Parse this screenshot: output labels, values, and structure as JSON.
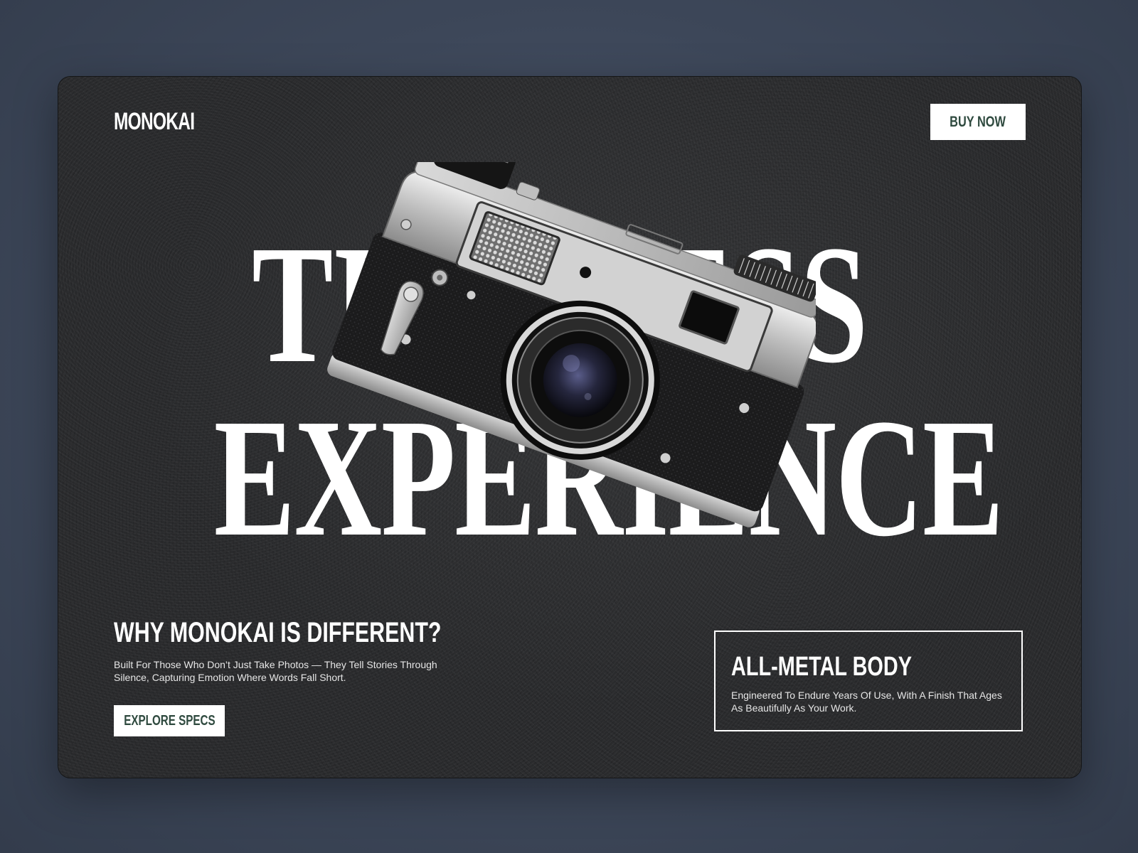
{
  "brand": {
    "logo": "MONOKAI"
  },
  "header": {
    "buy_label": "BUY NOW"
  },
  "hero": {
    "line1": "TIMELESS",
    "line2": "EXPERIENCE",
    "image_icon": "film-camera-illustration"
  },
  "why": {
    "title": "WHY MONOKAI IS DIFFERENT?",
    "body": "Built For Those Who Don’t Just Take Photos — They Tell Stories Through Silence, Capturing Emotion Where Words Fall Short.",
    "cta_label": "EXPLORE SPECS"
  },
  "feature": {
    "title": "ALL-METAL BODY",
    "body": "Engineered To Endure Years Of Use, With A Finish That Ages As Beautifully As Your Work."
  },
  "colors": {
    "background": "#3d4759",
    "card": "#2a2b2d",
    "accent_text": "#2f4a3f",
    "white": "#ffffff"
  }
}
